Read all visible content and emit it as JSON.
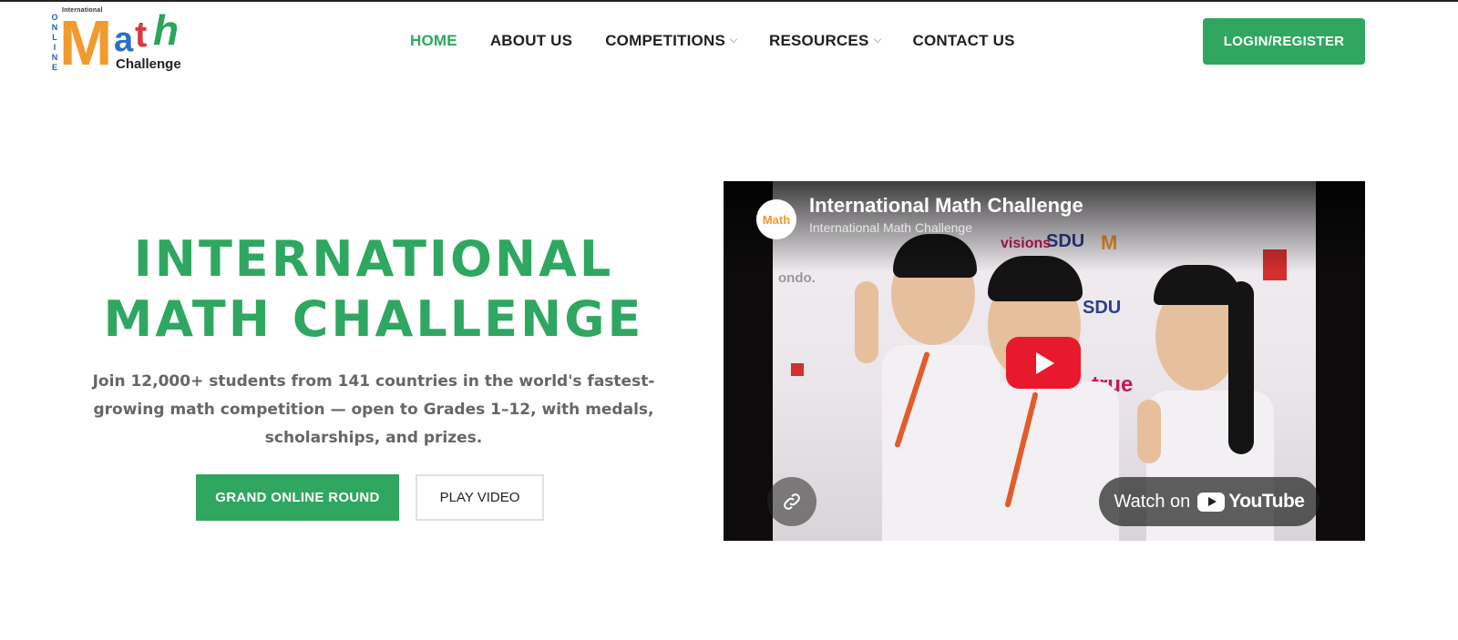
{
  "logo": {
    "international": "International",
    "online_letters": [
      "O",
      "N",
      "L",
      "I",
      "N",
      "E"
    ],
    "m": "M",
    "a": "a",
    "t": "t",
    "h": "h",
    "challenge": "Challenge"
  },
  "nav": {
    "items": [
      {
        "label": "HOME",
        "active": true,
        "dropdown": false
      },
      {
        "label": "ABOUT US",
        "active": false,
        "dropdown": false
      },
      {
        "label": "COMPETITIONS",
        "active": false,
        "dropdown": true
      },
      {
        "label": "RESOURCES",
        "active": false,
        "dropdown": true
      },
      {
        "label": "CONTACT US",
        "active": false,
        "dropdown": false
      }
    ],
    "login_label": "LOGIN/REGISTER"
  },
  "hero": {
    "title_line1": "INTERNATIONAL",
    "title_line2": "MATH CHALLENGE",
    "description": "Join 12,000+ students from 141 countries in the world's fastest-growing math competition — open to Grades 1–12, with medals, scholarships, and prizes.",
    "primary_button": "GRAND ONLINE ROUND",
    "secondary_button": "PLAY VIDEO"
  },
  "video": {
    "title": "International Math Challenge",
    "channel": "International Math Challenge",
    "avatar_text": "Math",
    "watch_on": "Watch on",
    "youtube": "YouTube"
  },
  "colors": {
    "brand_green": "#2fa760",
    "youtube_red": "#e8192c",
    "logo_orange": "#f29a2e",
    "logo_blue": "#2c6fc4"
  }
}
